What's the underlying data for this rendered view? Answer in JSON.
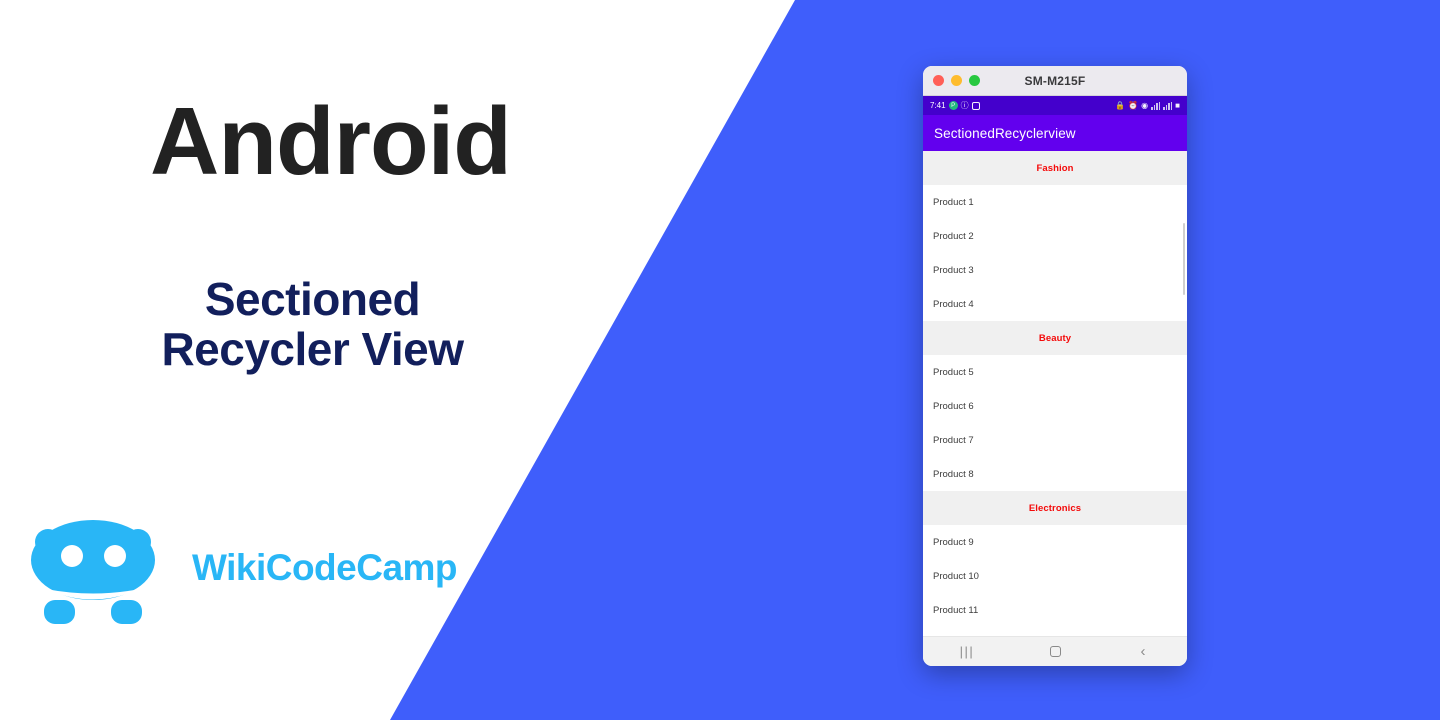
{
  "promo": {
    "title": "Android",
    "subtitle_line1": "Sectioned",
    "subtitle_line2": "Recycler View",
    "title_color": "#222222",
    "subtitle_color": "#121f5c",
    "background_color": "#ffffff",
    "accent_background_color": "#3f5efb"
  },
  "brand": {
    "name": "WikiCodeCamp",
    "color": "#29b6f6",
    "mark": "robot-mascot-logo"
  },
  "emulator": {
    "window_title": "SM-M215F",
    "traffic_lights": [
      "close",
      "minimize",
      "zoom"
    ],
    "statusbar": {
      "clock": "7:41",
      "left_icons": [
        "play-store-icon",
        "info-icon",
        "screenshot-icon"
      ],
      "right_icons": [
        "lock-icon",
        "alarm-icon",
        "wifi-icon",
        "signal-icon",
        "signal-icon-2",
        "battery-icon"
      ],
      "background_color": "#4400cc"
    },
    "appbar": {
      "title": "SectionedRecyclerview",
      "background_color": "#6200ee",
      "text_color": "#ffffff"
    },
    "list": {
      "header_background": "#f0f0f0",
      "header_text_color": "#f40a0a",
      "item_text_color": "#3c3c3c",
      "sections": [
        {
          "header": "Fashion",
          "items": [
            "Product 1",
            "Product 2",
            "Product 3",
            "Product 4"
          ]
        },
        {
          "header": "Beauty",
          "items": [
            "Product 5",
            "Product 6",
            "Product 7",
            "Product 8"
          ]
        },
        {
          "header": "Electronics",
          "items": [
            "Product 9",
            "Product 10",
            "Product 11"
          ]
        }
      ]
    },
    "navbar": {
      "recents_label": "|||",
      "home_label": "",
      "back_label": "‹",
      "background_color": "#f2f2f2"
    }
  }
}
